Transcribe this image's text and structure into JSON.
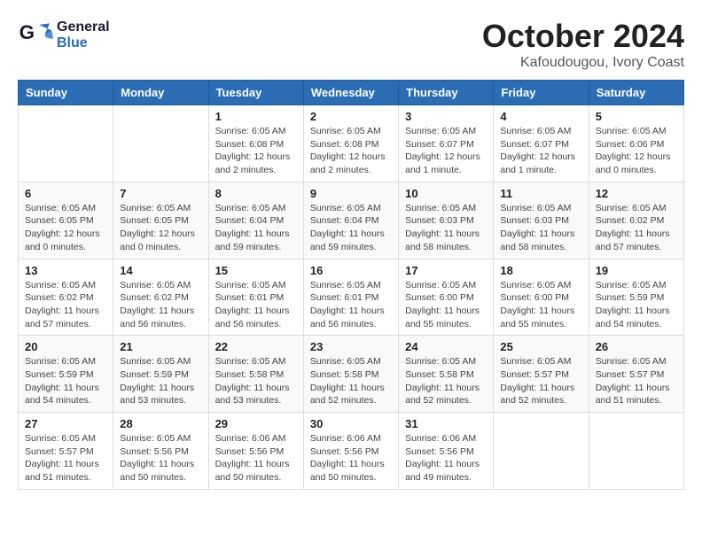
{
  "header": {
    "logo_general": "General",
    "logo_blue": "Blue",
    "month_title": "October 2024",
    "location": "Kafoudougou, Ivory Coast"
  },
  "calendar": {
    "days_of_week": [
      "Sunday",
      "Monday",
      "Tuesday",
      "Wednesday",
      "Thursday",
      "Friday",
      "Saturday"
    ],
    "weeks": [
      [
        {
          "day": "",
          "info": ""
        },
        {
          "day": "",
          "info": ""
        },
        {
          "day": "1",
          "info": "Sunrise: 6:05 AM\nSunset: 6:08 PM\nDaylight: 12 hours\nand 2 minutes."
        },
        {
          "day": "2",
          "info": "Sunrise: 6:05 AM\nSunset: 6:08 PM\nDaylight: 12 hours\nand 2 minutes."
        },
        {
          "day": "3",
          "info": "Sunrise: 6:05 AM\nSunset: 6:07 PM\nDaylight: 12 hours\nand 1 minute."
        },
        {
          "day": "4",
          "info": "Sunrise: 6:05 AM\nSunset: 6:07 PM\nDaylight: 12 hours\nand 1 minute."
        },
        {
          "day": "5",
          "info": "Sunrise: 6:05 AM\nSunset: 6:06 PM\nDaylight: 12 hours\nand 0 minutes."
        }
      ],
      [
        {
          "day": "6",
          "info": "Sunrise: 6:05 AM\nSunset: 6:05 PM\nDaylight: 12 hours\nand 0 minutes."
        },
        {
          "day": "7",
          "info": "Sunrise: 6:05 AM\nSunset: 6:05 PM\nDaylight: 12 hours\nand 0 minutes."
        },
        {
          "day": "8",
          "info": "Sunrise: 6:05 AM\nSunset: 6:04 PM\nDaylight: 11 hours\nand 59 minutes."
        },
        {
          "day": "9",
          "info": "Sunrise: 6:05 AM\nSunset: 6:04 PM\nDaylight: 11 hours\nand 59 minutes."
        },
        {
          "day": "10",
          "info": "Sunrise: 6:05 AM\nSunset: 6:03 PM\nDaylight: 11 hours\nand 58 minutes."
        },
        {
          "day": "11",
          "info": "Sunrise: 6:05 AM\nSunset: 6:03 PM\nDaylight: 11 hours\nand 58 minutes."
        },
        {
          "day": "12",
          "info": "Sunrise: 6:05 AM\nSunset: 6:02 PM\nDaylight: 11 hours\nand 57 minutes."
        }
      ],
      [
        {
          "day": "13",
          "info": "Sunrise: 6:05 AM\nSunset: 6:02 PM\nDaylight: 11 hours\nand 57 minutes."
        },
        {
          "day": "14",
          "info": "Sunrise: 6:05 AM\nSunset: 6:02 PM\nDaylight: 11 hours\nand 56 minutes."
        },
        {
          "day": "15",
          "info": "Sunrise: 6:05 AM\nSunset: 6:01 PM\nDaylight: 11 hours\nand 56 minutes."
        },
        {
          "day": "16",
          "info": "Sunrise: 6:05 AM\nSunset: 6:01 PM\nDaylight: 11 hours\nand 56 minutes."
        },
        {
          "day": "17",
          "info": "Sunrise: 6:05 AM\nSunset: 6:00 PM\nDaylight: 11 hours\nand 55 minutes."
        },
        {
          "day": "18",
          "info": "Sunrise: 6:05 AM\nSunset: 6:00 PM\nDaylight: 11 hours\nand 55 minutes."
        },
        {
          "day": "19",
          "info": "Sunrise: 6:05 AM\nSunset: 5:59 PM\nDaylight: 11 hours\nand 54 minutes."
        }
      ],
      [
        {
          "day": "20",
          "info": "Sunrise: 6:05 AM\nSunset: 5:59 PM\nDaylight: 11 hours\nand 54 minutes."
        },
        {
          "day": "21",
          "info": "Sunrise: 6:05 AM\nSunset: 5:59 PM\nDaylight: 11 hours\nand 53 minutes."
        },
        {
          "day": "22",
          "info": "Sunrise: 6:05 AM\nSunset: 5:58 PM\nDaylight: 11 hours\nand 53 minutes."
        },
        {
          "day": "23",
          "info": "Sunrise: 6:05 AM\nSunset: 5:58 PM\nDaylight: 11 hours\nand 52 minutes."
        },
        {
          "day": "24",
          "info": "Sunrise: 6:05 AM\nSunset: 5:58 PM\nDaylight: 11 hours\nand 52 minutes."
        },
        {
          "day": "25",
          "info": "Sunrise: 6:05 AM\nSunset: 5:57 PM\nDaylight: 11 hours\nand 52 minutes."
        },
        {
          "day": "26",
          "info": "Sunrise: 6:05 AM\nSunset: 5:57 PM\nDaylight: 11 hours\nand 51 minutes."
        }
      ],
      [
        {
          "day": "27",
          "info": "Sunrise: 6:05 AM\nSunset: 5:57 PM\nDaylight: 11 hours\nand 51 minutes."
        },
        {
          "day": "28",
          "info": "Sunrise: 6:05 AM\nSunset: 5:56 PM\nDaylight: 11 hours\nand 50 minutes."
        },
        {
          "day": "29",
          "info": "Sunrise: 6:06 AM\nSunset: 5:56 PM\nDaylight: 11 hours\nand 50 minutes."
        },
        {
          "day": "30",
          "info": "Sunrise: 6:06 AM\nSunset: 5:56 PM\nDaylight: 11 hours\nand 50 minutes."
        },
        {
          "day": "31",
          "info": "Sunrise: 6:06 AM\nSunset: 5:56 PM\nDaylight: 11 hours\nand 49 minutes."
        },
        {
          "day": "",
          "info": ""
        },
        {
          "day": "",
          "info": ""
        }
      ]
    ]
  }
}
